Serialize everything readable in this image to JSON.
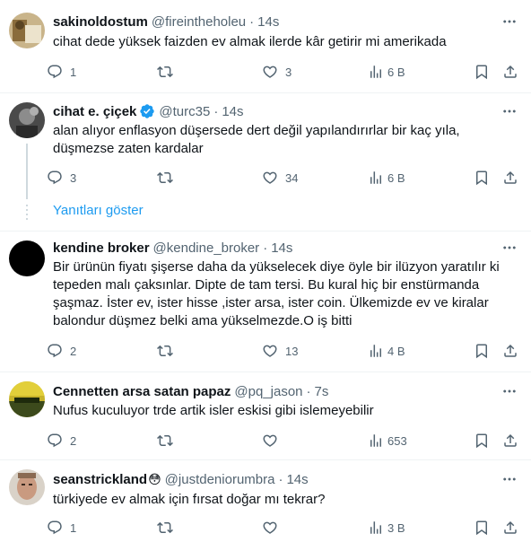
{
  "tweets": [
    {
      "name": "sakinoldostum",
      "handle": "@fireintheholeu",
      "time": "14s",
      "text": "cihat dede yüksek faizden ev almak ilerde kâr getirir mi amerikada",
      "replies": "1",
      "retweets": "",
      "likes": "3",
      "views": "6 B"
    },
    {
      "name": "cihat e. çiçek",
      "handle": "@turc35",
      "time": "14s",
      "verified": true,
      "text_lines": [
        "alan alıyor enflasyon düşersede dert değil yapılandırırlar bir kaç yıla,",
        "düşmezse zaten kardalar"
      ],
      "replies": "3",
      "retweets": "",
      "likes": "34",
      "views": "6 B"
    },
    {
      "name": "kendine broker",
      "handle": "@kendine_broker",
      "time": "14s",
      "text_lines": [
        "Bir ürünün fiyatı şişerse daha da yükselecek diye öyle bir ilüzyon yaratılır ki",
        "tepeden malı çaksınlar. Dipte de tam tersi. Bu kural hiç bir enstürmanda",
        "şaşmaz. İster ev, ister hisse ,ister arsa, ister coin. Ülkemizde ev ve kiralar",
        "balondur düşmez belki ama yükselmezde.O iş bitti"
      ],
      "replies": "2",
      "retweets": "",
      "likes": "13",
      "views": "4 B"
    },
    {
      "name": "Cennetten arsa satan papaz",
      "handle": "@pq_jason",
      "time": "7s",
      "text": "Nufus kuculuyor trde artik isler eskisi gibi islemeyebilir",
      "replies": "2",
      "retweets": "",
      "likes": "",
      "views": "653"
    },
    {
      "name": "seanstrickland",
      "emoji": "😳",
      "handle": "@justdeniorumbra",
      "time": "14s",
      "text": "türkiyede ev almak için fırsat doğar mı tekrar?",
      "replies": "1",
      "retweets": "",
      "likes": "",
      "views": "3 B"
    }
  ],
  "show_replies_label": "Yanıtları göster",
  "dot": "·",
  "colors": {
    "text": "#0f1419",
    "muted": "#536471",
    "link": "#1d9bf0",
    "verified": "#1d9bf0",
    "separator": "#eff3f4"
  },
  "icons": {
    "reply": "reply-icon",
    "retweet": "retweet-icon",
    "like": "heart-icon",
    "views": "views-icon",
    "bookmark": "bookmark-icon",
    "share": "share-icon",
    "more": "more-icon",
    "verified": "verified-badge-icon"
  }
}
